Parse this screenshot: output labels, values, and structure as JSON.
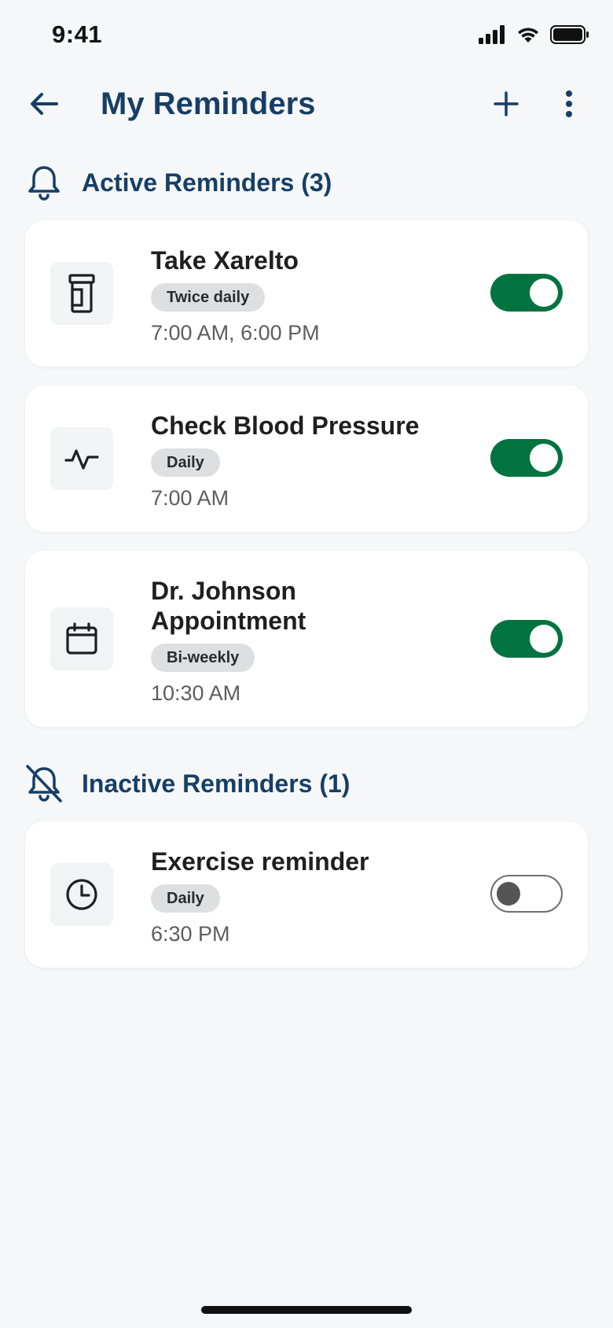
{
  "status_bar": {
    "time": "9:41"
  },
  "header": {
    "title": "My Reminders"
  },
  "sections": {
    "active": {
      "title": "Active Reminders (3)"
    },
    "inactive": {
      "title": "Inactive Reminders (1)"
    }
  },
  "reminders": [
    {
      "title": "Take Xarelto",
      "frequency": "Twice daily",
      "time": "7:00 AM, 6:00 PM",
      "icon": "pill-bottle-icon",
      "enabled": true
    },
    {
      "title": "Check Blood Pressure",
      "frequency": "Daily",
      "time": "7:00 AM",
      "icon": "heart-pulse-icon",
      "enabled": true
    },
    {
      "title": "Dr. Johnson Appointment",
      "frequency": "Bi-weekly",
      "time": "10:30 AM",
      "icon": "calendar-icon",
      "enabled": true
    },
    {
      "title": "Exercise reminder",
      "frequency": "Daily",
      "time": "6:30 PM",
      "icon": "clock-icon",
      "enabled": false
    }
  ],
  "colors": {
    "primary": "#163f66",
    "toggle_on": "#007340",
    "background": "#f6f7f8"
  }
}
